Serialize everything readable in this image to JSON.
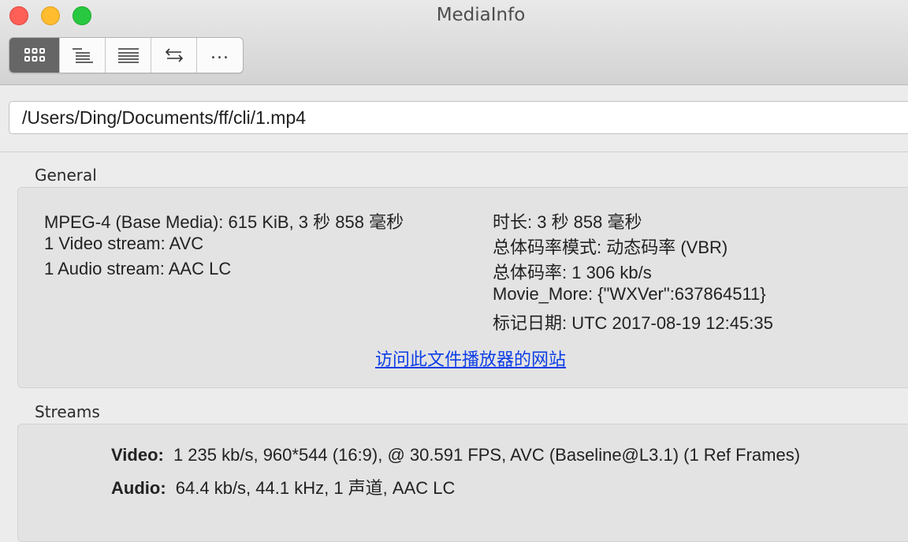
{
  "window": {
    "title": "MediaInfo"
  },
  "toolbar": {
    "buttons": [
      {
        "icon": "grid-icon",
        "active": true
      },
      {
        "icon": "tree-list-icon",
        "active": false
      },
      {
        "icon": "text-list-icon",
        "active": false
      },
      {
        "icon": "swap-arrows-icon",
        "active": false
      },
      {
        "icon": "more-icon",
        "label": "..."
      }
    ]
  },
  "path": {
    "value": "/Users/Ding/Documents/ff/cli/1.mp4"
  },
  "general": {
    "title": "General",
    "left_lines": [
      "MPEG-4 (Base Media): 615 KiB, 3 秒 858 毫秒",
      "1 Video stream: AVC",
      "1 Audio stream: AAC LC"
    ],
    "right_lines": [
      "时长: 3 秒 858 毫秒",
      "总体码率模式: 动态码率 (VBR)",
      "总体码率: 1 306 kb/s",
      "Movie_More: {\"WXVer\":637864511}",
      "标记日期: UTC 2017-08-19 12:45:35"
    ],
    "link": "访问此文件播放器的网站"
  },
  "streams": {
    "title": "Streams",
    "items": [
      {
        "label": "Video:",
        "value": "1 235 kb/s, 960*544 (16:9), @ 30.591 FPS, AVC (Baseline@L3.1) (1 Ref Frames)"
      },
      {
        "label": "Audio:",
        "value": "64.4 kb/s, 44.1 kHz, 1 声道, AAC LC"
      }
    ]
  }
}
